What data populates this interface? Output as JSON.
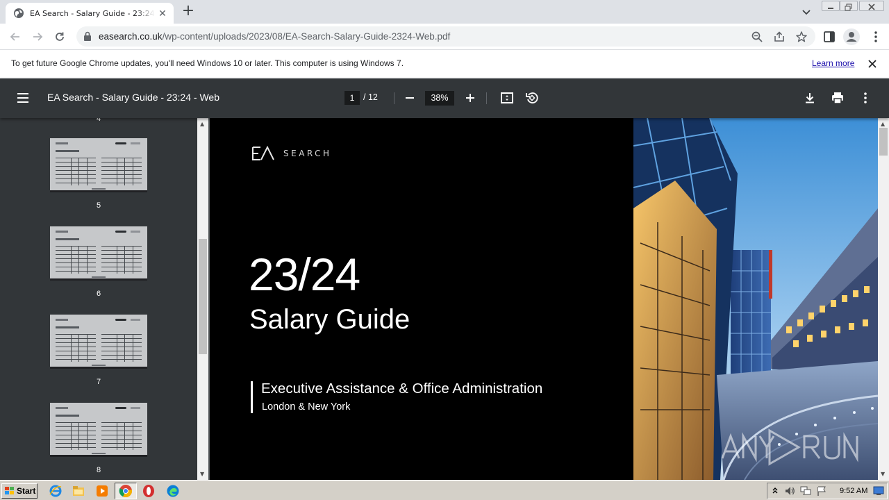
{
  "browser": {
    "tab": {
      "title": "EA Search - Salary Guide - 23:24 - Web"
    },
    "url": {
      "host": "easearch.co.uk",
      "path": "/wp-content/uploads/2023/08/EA-Search-Salary-Guide-2324-Web.pdf"
    },
    "infobar": {
      "message": "To get future Google Chrome updates, you'll need Windows 10 or later. This computer is using Windows 7.",
      "link": "Learn more"
    }
  },
  "pdf_toolbar": {
    "title": "EA Search - Salary Guide - 23:24 - Web",
    "current_page": "1",
    "total_pages": "/ 12",
    "zoom": "38%"
  },
  "sidebar": {
    "partial_page_number": "4",
    "thumbnails": [
      {
        "page": "5"
      },
      {
        "page": "6"
      },
      {
        "page": "7"
      },
      {
        "page": "8"
      }
    ]
  },
  "cover": {
    "logo_word": "SEARCH",
    "year": "23/24",
    "title": "Salary Guide",
    "subtitle": "Executive Assistance & Office Administration",
    "locations": "London & New York"
  },
  "taskbar": {
    "start_label": "Start",
    "clock": "9:52 AM"
  },
  "colors": {
    "pdf_chrome": "#323639",
    "viewer_bg": "#525659",
    "cover_bg": "#000000",
    "link": "#1a0dab"
  }
}
